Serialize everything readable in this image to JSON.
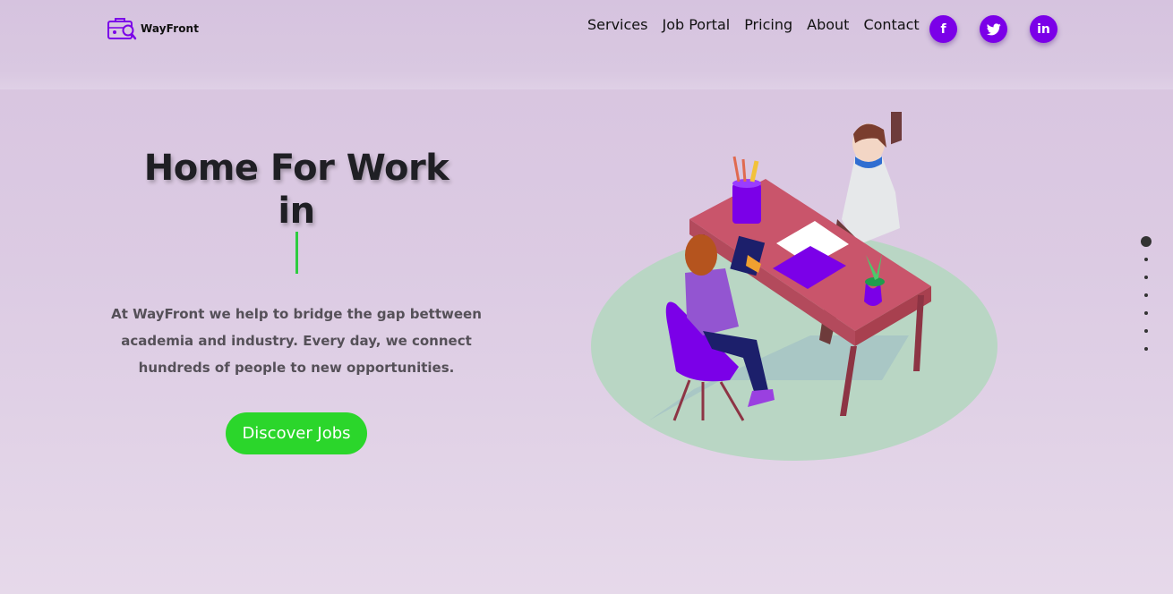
{
  "brand": {
    "name": "WayFront",
    "icon": "briefcase-search-icon"
  },
  "nav": {
    "items": [
      "Services",
      "Job Portal",
      "Pricing",
      "About",
      "Contact"
    ]
  },
  "social": [
    {
      "icon": "facebook-icon",
      "glyph": "f"
    },
    {
      "icon": "twitter-icon",
      "glyph": "🐦"
    },
    {
      "icon": "linkedin-icon",
      "glyph": "in"
    }
  ],
  "hero": {
    "title_line1": "Home For Work",
    "title_line2": "in",
    "description": "At WayFront we help to bridge the gap bettween academia and industry. Every day, we connect hundreds of people to new opportunities.",
    "cta_label": "Discover Jobs"
  },
  "slider": {
    "total": 7,
    "active": 1
  },
  "colors": {
    "accent": "#7b00e8",
    "cta": "#2bd62b",
    "cursor": "#2ecc40"
  }
}
